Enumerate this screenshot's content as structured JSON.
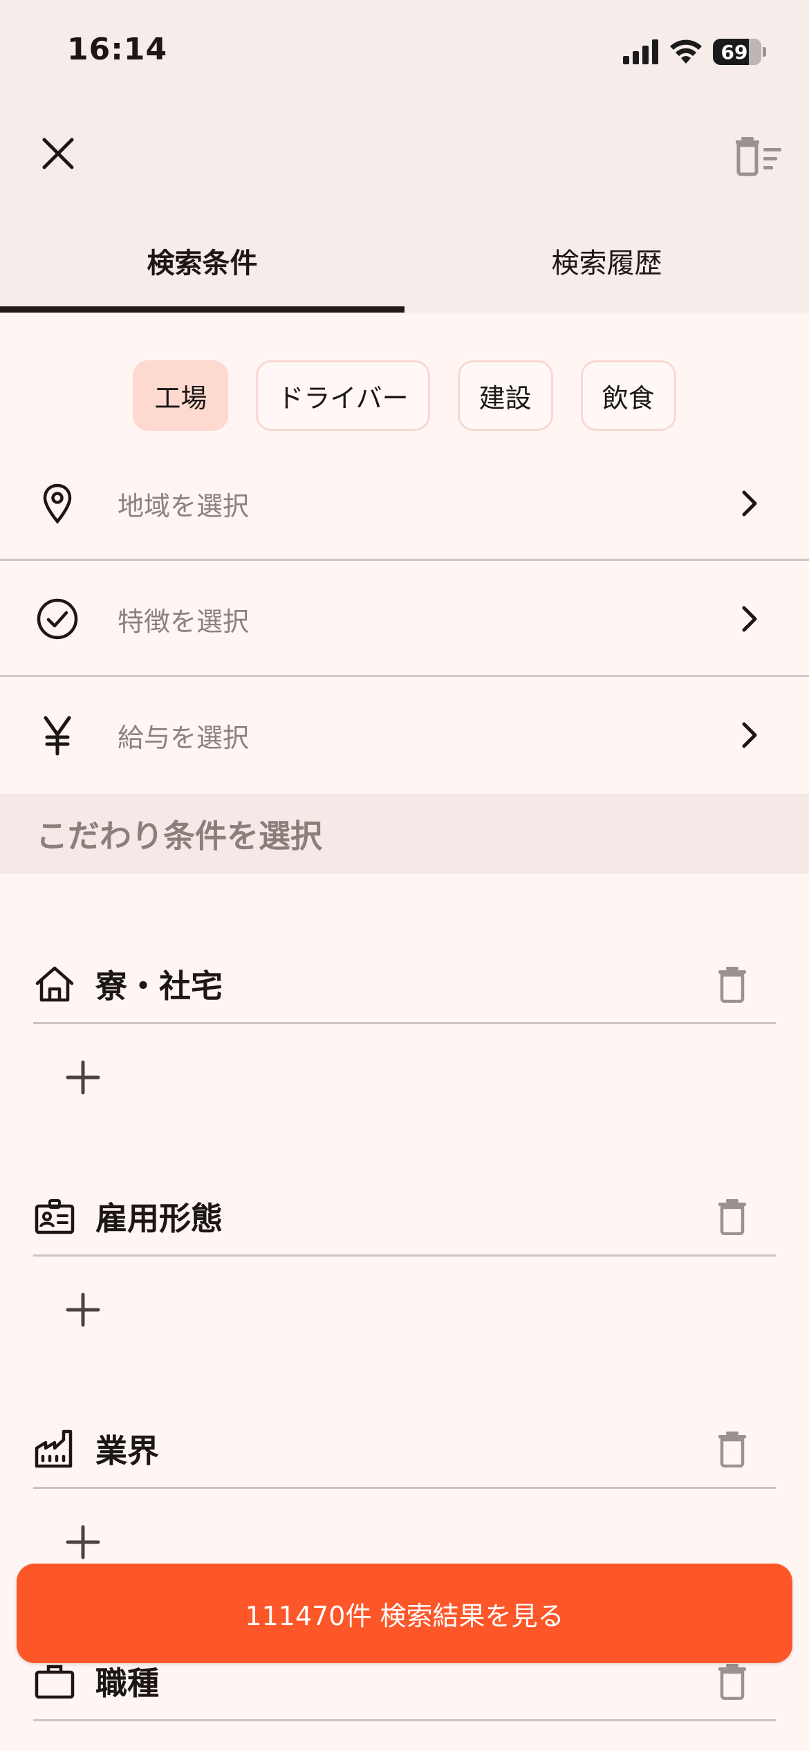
{
  "status_bar": {
    "time": "16:14",
    "battery": "69"
  },
  "header": {
    "close_icon": "close-icon",
    "clear_icon": "trash-filter-icon"
  },
  "tabs": [
    {
      "label": "検索条件",
      "active": true
    },
    {
      "label": "検索履歴",
      "active": false
    }
  ],
  "quick_chips": [
    {
      "label": "工場",
      "selected": true
    },
    {
      "label": "ドライバー",
      "selected": false
    },
    {
      "label": "建設",
      "selected": false
    },
    {
      "label": "飲食",
      "selected": false
    }
  ],
  "select_rows": [
    {
      "icon": "location-pin-icon",
      "label": "地域を選択"
    },
    {
      "icon": "check-circle-icon",
      "label": "特徴を選択"
    },
    {
      "icon": "yen-icon",
      "label": "給与を選択"
    }
  ],
  "section_title": "こだわり条件を選択",
  "conditions": [
    {
      "icon": "house-icon",
      "title": "寮・社宅"
    },
    {
      "icon": "id-card-icon",
      "title": "雇用形態"
    },
    {
      "icon": "factory-icon",
      "title": "業界"
    },
    {
      "icon": "briefcase-icon",
      "title": "職種"
    }
  ],
  "cta": {
    "label": "111470件 検索結果を見る"
  },
  "colors": {
    "accent": "#fd5729",
    "chip_selected": "#fdd9cf",
    "background": "#fff6f4",
    "header_bg": "#f6ecea"
  }
}
